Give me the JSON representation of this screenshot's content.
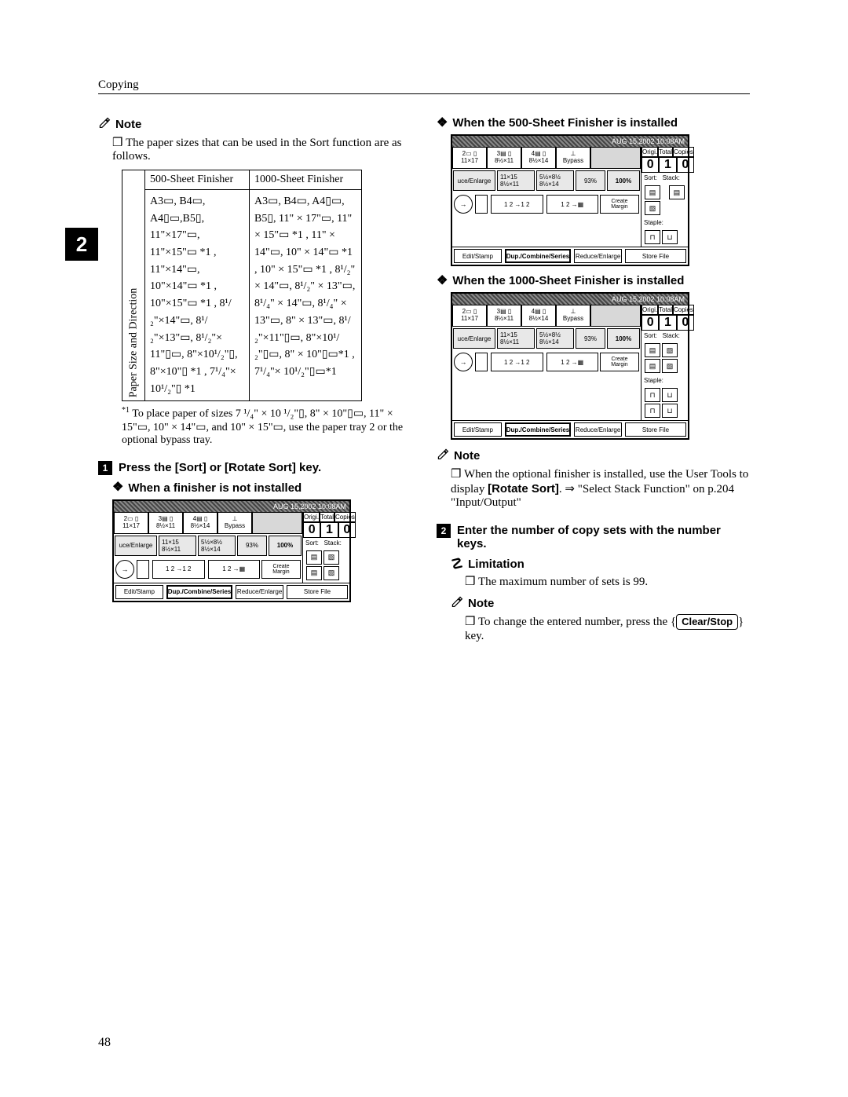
{
  "header": {
    "chapter": "Copying"
  },
  "sidebar_tab": "2",
  "page_number": "48",
  "note_label": "Note",
  "limitation_label": "Limitation",
  "left": {
    "note_item": "The paper sizes that can be used in the Sort function are as follows.",
    "table": {
      "row_header": "Paper Size and Direction",
      "col1_head": "500-Sheet Finisher",
      "col2_head": "1000-Sheet Finisher",
      "col1_body": "A3▭, B4▭, A4▯▭,B5▯, 11\"×17\"▭, 11\"×15\"▭ *1 , 11\"×14\"▭, 10\"×14\"▭ *1 , 10\"×15\"▭ *1 , 8¹/₂\"×14\"▭, 8¹/₂\"×13\"▭, 8¹/₂\"× 11\"▯▭, 8\"×10¹/₂\"▯, 8\"×10\"▯ *1 , 7¹/₄\"× 10¹/₂\"▯ *1",
      "col2_body": "A3▭, B4▭, A4▯▭, B5▯, 11\" × 17\"▭, 11\" × 15\"▭ *1 , 11\" × 14\"▭, 10\" × 14\"▭ *1 , 10\" × 15\"▭ *1 , 8¹/₂\" × 14\"▭, 8¹/₂\" × 13\"▭, 8¹/₄\" × 14\"▭, 8¹/₄\" × 13\"▭, 8\" × 13\"▭, 8¹/₂\"×11\"▯▭, 8\"×10¹/₂\"▯▭, 8\" × 10\"▯▭*1 , 7¹/₄\"× 10¹/₂\"▯▭*1"
    },
    "footnote_marker": "*1",
    "footnote_text": "To place paper of sizes 7 ¹/₄\" × 10 ¹/₂\"▯, 8\" × 10\"▯▭, 11\" × 15\"▭, 10\" × 14\"▭, and 10\" × 15\"▭, use the paper tray 2 or the optional bypass tray.",
    "step1": "Press the [Sort] or [Rotate Sort] key.",
    "diamond_nofinisher": "When a finisher is not installed"
  },
  "right": {
    "diamond_500": "When the 500-Sheet Finisher is installed",
    "diamond_1000": "When the 1000-Sheet Finisher is installed",
    "note_item_pre": "When the optional finisher is installed, use the User Tools to display ",
    "rotate_sort": "[Rotate Sort]",
    "arrow": " ⇒ ",
    "note_item_post": "\"Select Stack Function\" on p.204 \"Input/Output\"",
    "step2": "Enter the number of copy sets with the number keys.",
    "limit_item": "The maximum number of sets is 99.",
    "note2_pre": "To change the entered number, press the ",
    "clear_stop": "Clear/Stop",
    "note2_post": " key."
  },
  "lcd": {
    "datetime": "AUG  15,2002 10:08AM",
    "orig": "Origi.",
    "total": "Total",
    "copies": "Copies",
    "orig_v": "0",
    "total_v": "1",
    "copies_v": "0",
    "sort": "Sort:",
    "stack": "Stack:",
    "staple": "Staple:",
    "t1_a": "2▭ ▯",
    "t1_b": "11×17",
    "t2_a": "3▤ ▯",
    "t2_b": "8½×11",
    "t3_a": "4▤ ▯",
    "t3_b": "8½×14",
    "t4_a": "⊥",
    "t4_b": "Bypass",
    "re_label": "uce/Enlarge",
    "re_b1": "11×15 8½×11",
    "re_b2": "5½×8½ 8½×14",
    "re_pct": "93%",
    "re_100": "100%",
    "cm1": "Create",
    "cm2": "Margin",
    "bb1": "Edit/Stamp",
    "bb2": "Dup./Combine/Series",
    "bb3": "Reduce/Enlarge",
    "sf": "Store File"
  }
}
